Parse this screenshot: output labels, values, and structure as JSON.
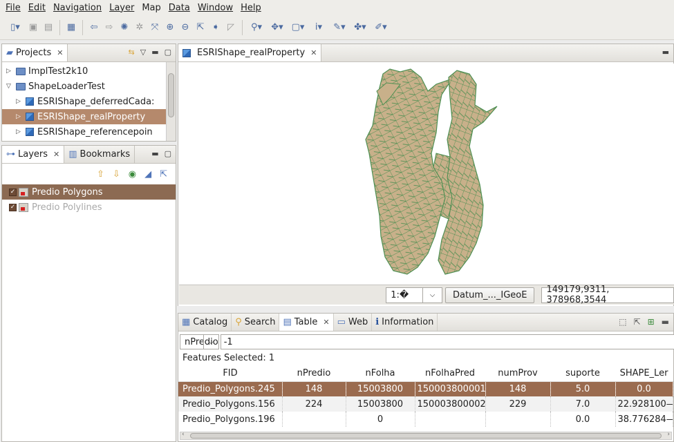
{
  "menu": [
    "File",
    "Edit",
    "Navigation",
    "Layer",
    "Map",
    "Data",
    "Window",
    "Help"
  ],
  "projects_panel": {
    "title": "Projects",
    "items": [
      {
        "label": "ImplTest2k10"
      },
      {
        "label": "ShapeLoaderTest"
      },
      {
        "label": "ESRIShape_deferredCada:"
      },
      {
        "label": "ESRIShape_realProperty"
      },
      {
        "label": "ESRIShape_referencepoin"
      }
    ]
  },
  "layers_panel": {
    "tab_layers": "Layers",
    "tab_bookmarks": "Bookmarks",
    "layers": [
      {
        "label": "Predio Polygons"
      },
      {
        "label": "Predio Polylines"
      }
    ]
  },
  "map_editor": {
    "tab_title": "ESRIShape_realProperty",
    "fill_color": "#c8b08a",
    "stroke_color": "#4e8f52"
  },
  "status": {
    "scale": "1:�",
    "datum": "Datum_..._IGeoE",
    "coords": "149179,9311, 378968,3544"
  },
  "bottom_tabs": {
    "catalog": "Catalog",
    "search": "Search",
    "table": "Table",
    "web": "Web",
    "information": "Information"
  },
  "table_view": {
    "filter_field": "nPredio",
    "filter_value": "-1",
    "features_selected": "Features Selected: 1",
    "columns": [
      "FID",
      "nPredio",
      "nFolha",
      "nFolhaPred",
      "numProv",
      "suporte",
      "SHAPE_Ler"
    ],
    "rows": [
      [
        "Predio_Polygons.245",
        "148",
        "15003800",
        "150003800001—",
        "148",
        "5.0",
        "0.0"
      ],
      [
        "Predio_Polygons.156",
        "224",
        "15003800",
        "150003800002—",
        "229",
        "7.0",
        "22.928100—"
      ],
      [
        "Predio_Polygons.196",
        "",
        "0",
        "",
        "",
        "0.0",
        "38.776284—"
      ]
    ]
  }
}
